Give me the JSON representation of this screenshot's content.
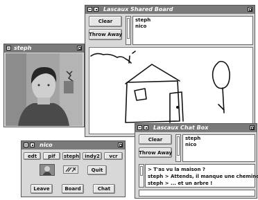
{
  "video": {
    "title": "steph"
  },
  "board": {
    "title": "Lascaux Shared Board",
    "clear_label": "Clear",
    "throw_away_label": "Throw Away",
    "users": [
      "steph",
      "nico"
    ]
  },
  "chat": {
    "title": "Lascaux Chat Box",
    "clear_label": "Clear",
    "throw_away_label": "Throw Away",
    "users": [
      "steph",
      "nico"
    ],
    "messages": [
      "> T'as vu la maison ?",
      "steph > Attends, il manque une cheminee",
      "steph > ... et un arbre !"
    ]
  },
  "control": {
    "title": "nico",
    "tools": [
      "edt",
      "pif",
      "steph",
      "indy2",
      "vcr"
    ],
    "quit_label": "Quit",
    "leave_label": "Leave",
    "board_label": "Board",
    "chat_label": "Chat"
  }
}
